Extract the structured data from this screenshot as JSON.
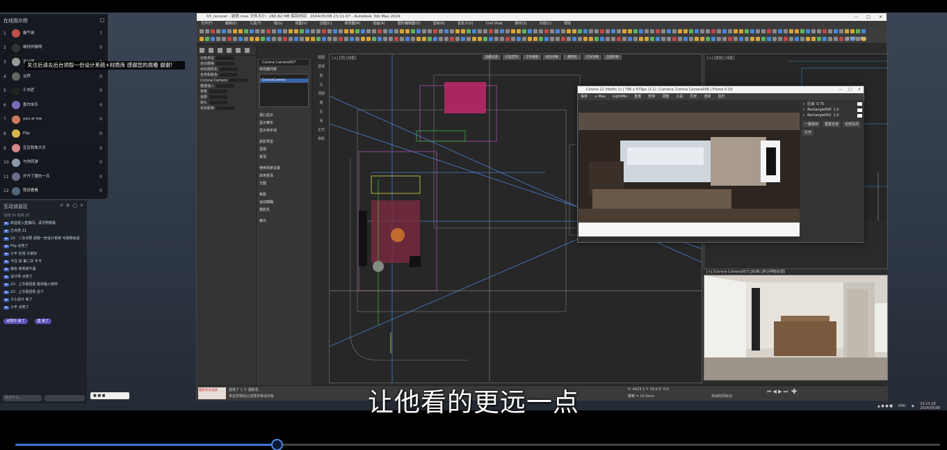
{
  "viewer_panel": {
    "title": "在线观众榜",
    "notice": "关注后请去后台领取一份设计系统+材质库 感谢您的观看 谢谢!",
    "viewers": [
      {
        "rank": "1",
        "name": "霸气哥",
        "score": "7",
        "color": "#c0504d"
      },
      {
        "rank": "2",
        "name": "缘份的咖啡",
        "score": "0",
        "color": "#333333"
      },
      {
        "rank": "3",
        "name": "设计师",
        "score": "0",
        "color": "#999999"
      },
      {
        "rank": "4",
        "name": "淡然",
        "score": "0",
        "color": "#666666"
      },
      {
        "rank": "5",
        "name": "小木匠",
        "score": "0",
        "color": "#222222"
      },
      {
        "rank": "6",
        "name": "墨白虫乐",
        "score": "0",
        "color": "#7a6ab8"
      },
      {
        "rank": "7",
        "name": "you ai me",
        "score": "0",
        "color": "#c97b5a"
      },
      {
        "rank": "8",
        "name": "Flip",
        "score": "0",
        "color": "#d4b44a"
      },
      {
        "rank": "9",
        "name": "豆豆和魚大乐",
        "score": "0",
        "color": "#d48888"
      },
      {
        "rank": "10",
        "name": "与你同游",
        "score": "0",
        "color": "#8899aa"
      },
      {
        "rank": "11",
        "name": "开开了摆白一兵",
        "score": "0",
        "color": "#6b6b8a"
      },
      {
        "rank": "12",
        "name": "我说看看",
        "score": "0",
        "color": "#556677"
      }
    ]
  },
  "chat_panel": {
    "title": "互动消息区",
    "stats": "在线 31  在线 25",
    "messages": [
      "欢迎进入直播间，请文明观看",
      "已点亮 21",
      "22：二次点赞 获取一份设计系统 可视频会话",
      "Flip 点亮了",
      "小平 在线 大家好",
      "卡住 说 第二次 不卡",
      "缘份 老师真牛逼",
      "设计师 点亮了",
      "22：上次看回看 能出输入到你",
      "22：上次看回看 这个",
      "小小设计 来了",
      "小平 点亮了"
    ],
    "pills": [
      "点赞中 来了",
      "莫 来了"
    ],
    "input_placeholder": "说点什么..."
  },
  "max": {
    "title": "03_recover - 厨房.max  文件大小：260.82 MB  保存时间：2024/05/08 23:11:07 - Autodesk 3ds Max 2024",
    "menus": [
      "文件(F)",
      "编辑(E)",
      "工具(T)",
      "组(G)",
      "视图(V)",
      "创建(C)",
      "修改器(M)",
      "动画(A)",
      "图形编辑器(D)",
      "渲染(R)",
      "自定义(U)",
      "Civil View",
      "脚本(S)",
      "内容(C)",
      "帮助"
    ],
    "workspace": "工作区：默认",
    "command_panel_items": [
      "对象类型",
      "自动栅格",
      "目标摄影机",
      "名称和颜色",
      "Corona Camera",
      "键盘输入",
      "参数",
      "视野",
      "镜头",
      "目标距离"
    ],
    "modifier_panel": {
      "title": "Corona Camera007",
      "list_label": "修改器列表",
      "selected": "CoronaCamera",
      "sections": [
        "视口显示",
        "显示锥形",
        "显示地平线",
        "投影类型",
        "透视",
        "景深",
        "使用场景设置",
        "启用景深",
        "光圈",
        "焦距",
        "运动模糊",
        "摄影机",
        "曝光"
      ]
    },
    "side_labels": [
      "视图",
      "透视",
      "前",
      "左",
      "顶部",
      "底",
      "右",
      "后",
      "正交",
      "相机"
    ],
    "viewport_main_label": "[+] [顶] [线框]",
    "viewport_tabs": [
      "选择过滤",
      "已选定的",
      "工作视图",
      "组合对象",
      "摄影机",
      "灯光对象",
      "全部对象"
    ],
    "viewport_right_label": "[+] [透视] [线框]",
    "viewport_camera_label": "[+] [Corona Camera007] [标准] [默认明暗处理]",
    "status": {
      "warn": "摄影机未选择",
      "line1": "选择了 1 个 摄影机",
      "line2": "单击并拖动以选择并移动对象",
      "coords": "X: 4423.1  Y: 19.9  Z: 0.0",
      "grid": "栅格 = 10.0mm",
      "time": "添加时间标记"
    }
  },
  "render_window": {
    "title": "Corona 12 (Hotfix 1) | 796 x 473px (1:1) | Camera: Corona Camera006 | Frame 0 (0)",
    "toolbar": [
      "保存",
      "+ Max",
      "LightMix",
      "重置",
      "暂停",
      "调整",
      "工具",
      "历史",
      "渲染",
      "显示"
    ],
    "layers": [
      {
        "name": "区域",
        "value": "0.75"
      },
      {
        "name": "Rectangle006",
        "value": "1.0"
      },
      {
        "name": "Rectangle002",
        "value": "1.0"
      }
    ],
    "side_buttons": [
      "一键保存",
      "重置全部",
      "全部关闭",
      "打开"
    ]
  },
  "subtitle": "让他看的更远一点",
  "taskbar": {
    "lang": "ENG",
    "time": "23:13:18",
    "date": "2024/05/08"
  },
  "progress": {
    "fraction": 0.283
  }
}
